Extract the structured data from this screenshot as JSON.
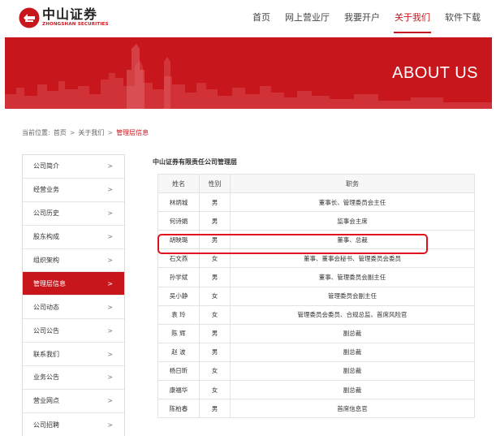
{
  "header": {
    "logo": {
      "cn": "中山证券",
      "en": "ZHONGSHAN SECURITIES"
    },
    "nav": [
      {
        "label": "首页",
        "active": false
      },
      {
        "label": "网上营业厅",
        "active": false
      },
      {
        "label": "我要开户",
        "active": false
      },
      {
        "label": "关于我们",
        "active": true
      },
      {
        "label": "软件下载",
        "active": false
      }
    ]
  },
  "banner": {
    "title": "ABOUT US"
  },
  "breadcrumb": {
    "prefix": "当前位置:",
    "items": [
      "首页",
      "关于我们"
    ],
    "separator": ">",
    "current": "管理层信息"
  },
  "sidebar": {
    "arrow": ">",
    "items": [
      {
        "label": "公司简介",
        "active": false
      },
      {
        "label": "经营业务",
        "active": false
      },
      {
        "label": "公司历史",
        "active": false
      },
      {
        "label": "股东构成",
        "active": false
      },
      {
        "label": "组织架构",
        "active": false
      },
      {
        "label": "管理层信息",
        "active": true
      },
      {
        "label": "公司动态",
        "active": false
      },
      {
        "label": "公司公告",
        "active": false
      },
      {
        "label": "联系我们",
        "active": false
      },
      {
        "label": "业务公告",
        "active": false
      },
      {
        "label": "营业网点",
        "active": false
      },
      {
        "label": "公司招聘",
        "active": false
      }
    ]
  },
  "main": {
    "title": "中山证券有限责任公司管理层",
    "table": {
      "headers": [
        "姓名",
        "性别",
        "职务"
      ],
      "rows": [
        [
          "林炳城",
          "男",
          "董事长、管理委员会主任"
        ],
        [
          "何诗娟",
          "男",
          "监事会主席"
        ],
        [
          "胡映璐",
          "男",
          "董事、总裁"
        ],
        [
          "石文燕",
          "女",
          "董事、董事会秘书、管理委员会委员"
        ],
        [
          "孙学斌",
          "男",
          "董事、管理委员会副主任"
        ],
        [
          "吴小静",
          "女",
          "管理委员会副主任"
        ],
        [
          "袁 玲",
          "女",
          "管理委员会委员、合规总监、首席风险官"
        ],
        [
          "陈 辉",
          "男",
          "副总裁"
        ],
        [
          "赵 波",
          "男",
          "副总裁"
        ],
        [
          "杨日昕",
          "女",
          "副总裁"
        ],
        [
          "康福华",
          "女",
          "副总裁"
        ],
        [
          "陈柏春",
          "男",
          "首席信息官"
        ]
      ],
      "highlighted_row": 2
    }
  },
  "colors": {
    "brand": "#c8161d",
    "highlight_box": "#e0111b"
  }
}
